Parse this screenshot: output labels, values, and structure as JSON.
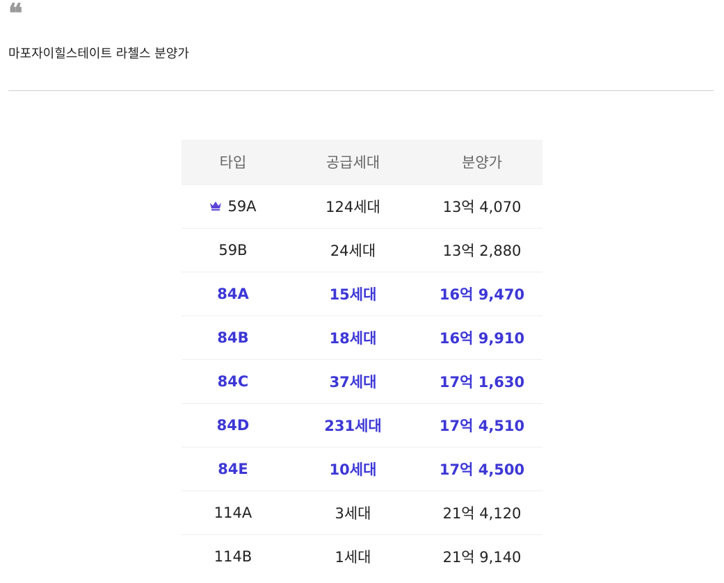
{
  "quote_mark": "❝",
  "heading": "마포자이힐스테이트 라첼스 분양가",
  "table": {
    "headers": [
      "타입",
      "공급세대",
      "분양가"
    ],
    "rows": [
      {
        "type": "59A",
        "units": "124세대",
        "price": "13억 4,070",
        "highlight": false,
        "icon": "crown-icon"
      },
      {
        "type": "59B",
        "units": "24세대",
        "price": "13억 2,880",
        "highlight": false
      },
      {
        "type": "84A",
        "units": "15세대",
        "price": "16억 9,470",
        "highlight": true
      },
      {
        "type": "84B",
        "units": "18세대",
        "price": "16억 9,910",
        "highlight": true
      },
      {
        "type": "84C",
        "units": "37세대",
        "price": "17억 1,630",
        "highlight": true
      },
      {
        "type": "84D",
        "units": "231세대",
        "price": "17억 4,510",
        "highlight": true
      },
      {
        "type": "84E",
        "units": "10세대",
        "price": "17억 4,500",
        "highlight": true
      },
      {
        "type": "114A",
        "units": "3세대",
        "price": "21억 4,120",
        "highlight": false
      },
      {
        "type": "114B",
        "units": "1세대",
        "price": "21억 9,140",
        "highlight": false
      }
    ]
  },
  "colors": {
    "highlight_text": "#3d37d6",
    "header_bg": "#f5f5f5",
    "header_text": "#666666",
    "crown": "#5b45d6"
  }
}
